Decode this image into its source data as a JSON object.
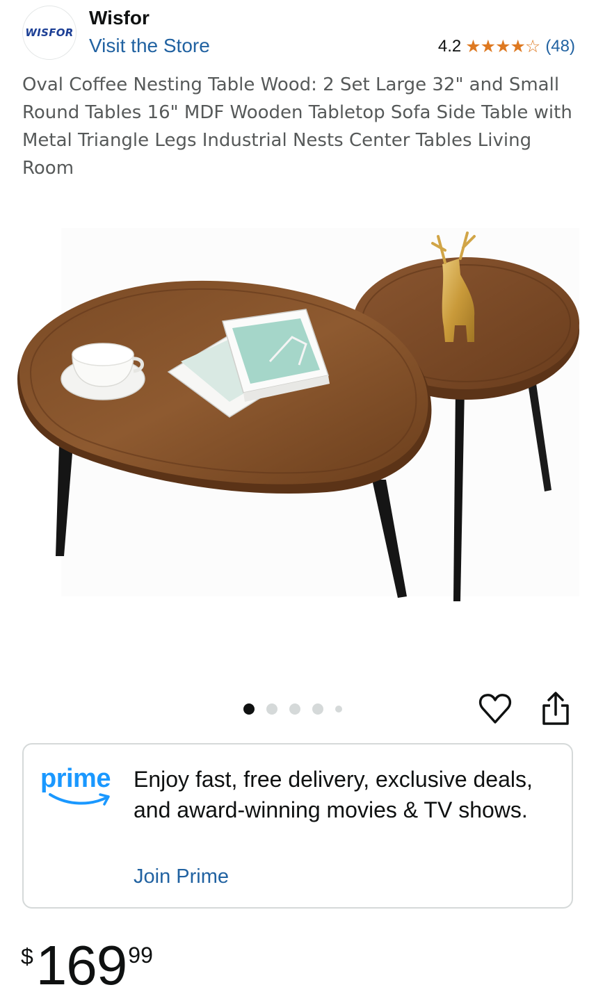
{
  "store": {
    "logo_text": "WISFOR",
    "name": "Wisfor",
    "link_label": "Visit the Store",
    "rating_value": "4.2",
    "rating_stars": 4.2,
    "stars_glyphs": "★★★★☆",
    "rating_count": "(48)"
  },
  "product": {
    "title": "Oval Coffee Nesting Table Wood: 2 Set Large 32\" and Small Round Tables 16\" MDF Wooden Tabletop Sofa Side Table with Metal Triangle Legs Industrial Nests Center Tables Living Room",
    "image": {
      "subject": "two walnut-wood nesting coffee tables with black tapered legs, white cup and saucer, books and gold deer figurine"
    }
  },
  "carousel": {
    "dot_count": 5,
    "active_index": 0
  },
  "actions": {
    "heart_icon": "heart-icon",
    "share_icon": "share-icon"
  },
  "prime": {
    "logo_word": "prime",
    "text": "Enjoy fast, free delivery, exclusive deals, and award-winning movies & TV shows.",
    "link_label": "Join Prime"
  },
  "price": {
    "symbol": "$",
    "whole": "169",
    "fraction": "99"
  },
  "colors": {
    "link": "#2162a1",
    "star": "#de7921",
    "prime_blue": "#1a98ff",
    "border": "#d5d9d9"
  }
}
